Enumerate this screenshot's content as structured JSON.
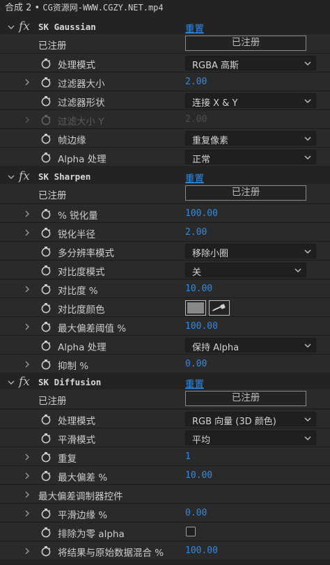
{
  "title": {
    "prefix": "合成 2 • ",
    "file": "CG资源网-WWW.CGZY.NET.mp4"
  },
  "common": {
    "reset": "重置",
    "registered": "已注册",
    "registered_button": "已注册"
  },
  "gaussian": {
    "name": "SK Gaussian",
    "mode_label": "处理模式",
    "mode_value": "RGBA 高斯",
    "filter_size_label": "过滤器大小",
    "filter_size_value": "2.00",
    "filter_shape_label": "过滤器形状",
    "filter_shape_value": "连接 X & Y",
    "size_y_label": "过滤大小 Y",
    "size_y_value": "2.00",
    "edge_label": "帧边缘",
    "edge_value": "重复像素",
    "alpha_label": "Alpha 处理",
    "alpha_value": "正常"
  },
  "sharpen": {
    "name": "SK Sharpen",
    "amount_label": "% 锐化量",
    "amount_value": "100.00",
    "radius_label": "锐化半径",
    "radius_value": "2.00",
    "multires_label": "多分辨率模式",
    "multires_value": "移除小圈",
    "contrast_mode_label": "对比度模式",
    "contrast_mode_value": "关",
    "contrast_label": "对比度 %",
    "contrast_value": "10.00",
    "contrast_color_label": "对比度颜色",
    "max_dev_label": "最大偏差阈值 %",
    "max_dev_value": "100.00",
    "alpha_label": "Alpha 处理",
    "alpha_value": "保持 Alpha",
    "suppress_label": "抑制 %",
    "suppress_value": "0.00"
  },
  "diffusion": {
    "name": "SK Diffusion",
    "mode_label": "处理模式",
    "mode_value": "RGB 向量 (3D 颜色)",
    "smooth_mode_label": "平滑模式",
    "smooth_mode_value": "平均",
    "repeat_label": "重复",
    "repeat_value": "1",
    "max_dev_label": "最大偏差 %",
    "max_dev_value": "10.00",
    "modulator_label": "最大偏差调制器控件",
    "smooth_edge_label": "平滑边缘 %",
    "smooth_edge_value": "0.00",
    "exclude_label": "排除为零 alpha",
    "blend_label": "将结果与原始数据混合 %",
    "blend_value": "100.00"
  },
  "colors": {
    "accent": "#2d8ceb",
    "swatch": "#888888"
  }
}
